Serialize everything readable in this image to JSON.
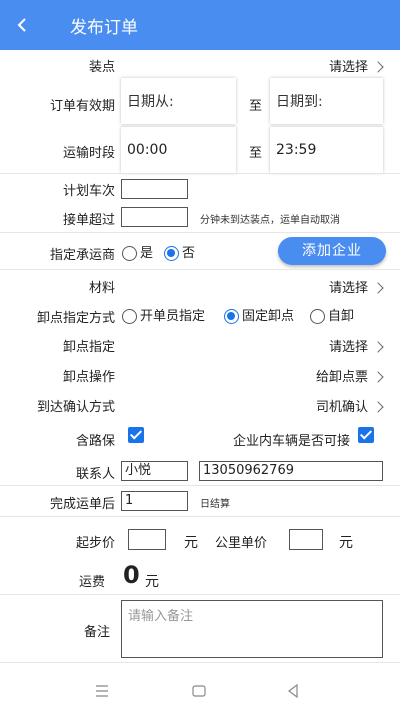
{
  "header": {
    "title": "发布订单"
  },
  "load_point": {
    "label": "装点",
    "action": "请选择"
  },
  "validity": {
    "label": "订单有效期",
    "from_placeholder": "日期从:",
    "sep": "至",
    "to_placeholder": "日期到:"
  },
  "transport_time": {
    "label": "运输时段",
    "from": "00:00",
    "sep": "至",
    "to": "23:59"
  },
  "plan_trips": {
    "label": "计划车次",
    "value": ""
  },
  "accept_timeout": {
    "label": "接单超过",
    "value": "",
    "hint": "分钟未到达装点，运单自动取消"
  },
  "carrier": {
    "label": "指定承运商",
    "opt_yes": "是",
    "opt_no": "否",
    "add_button": "添加企业"
  },
  "material": {
    "label": "材料",
    "action": "请选择"
  },
  "unload_mode": {
    "label": "卸点指定方式",
    "opt1": "开单员指定",
    "opt2": "固定卸点",
    "opt3": "自卸"
  },
  "unload_point": {
    "label": "卸点指定",
    "action": "请选择"
  },
  "unload_op": {
    "label": "卸点操作",
    "action": "给卸点票"
  },
  "arrival_confirm": {
    "label": "到达确认方式",
    "action": "司机确认"
  },
  "road_insurance": {
    "label": "含路保"
  },
  "internal_vehicle": {
    "label": "企业内车辆是否可接"
  },
  "contact": {
    "label": "联系人",
    "name": "小悦",
    "phone": "13050962769"
  },
  "settlement": {
    "label": "完成运单后",
    "value": "1",
    "unit": "日结算"
  },
  "pricing": {
    "start_label": "起步价",
    "start_unit": "元",
    "km_label": "公里单价",
    "km_unit": "元"
  },
  "freight": {
    "label": "运费",
    "value": "0",
    "unit": "元"
  },
  "remark": {
    "label": "备注",
    "placeholder": "请输入备注"
  },
  "colors": {
    "primary": "#4a8df0",
    "check": "#1a73e8"
  }
}
